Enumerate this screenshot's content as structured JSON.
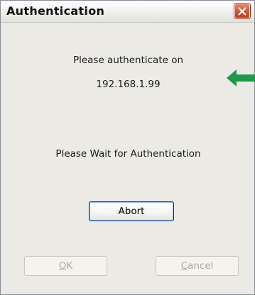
{
  "window": {
    "title": "Authentication",
    "close_icon": "close-icon"
  },
  "message": {
    "line1": "Please authenticate on",
    "address": "192.168.1.99",
    "status": "Please Wait for Authentication"
  },
  "annotation": {
    "arrow_icon": "left-arrow-icon",
    "arrow_color": "#1e9a4a"
  },
  "buttons": {
    "abort_label": "Abort",
    "ok_mnemonic": "O",
    "ok_rest": "K",
    "cancel_mnemonic": "C",
    "cancel_rest": "ancel"
  },
  "colors": {
    "dialog_bg": "#ebeae4",
    "close_button": "#d9502f",
    "disabled_text": "#aca899"
  }
}
